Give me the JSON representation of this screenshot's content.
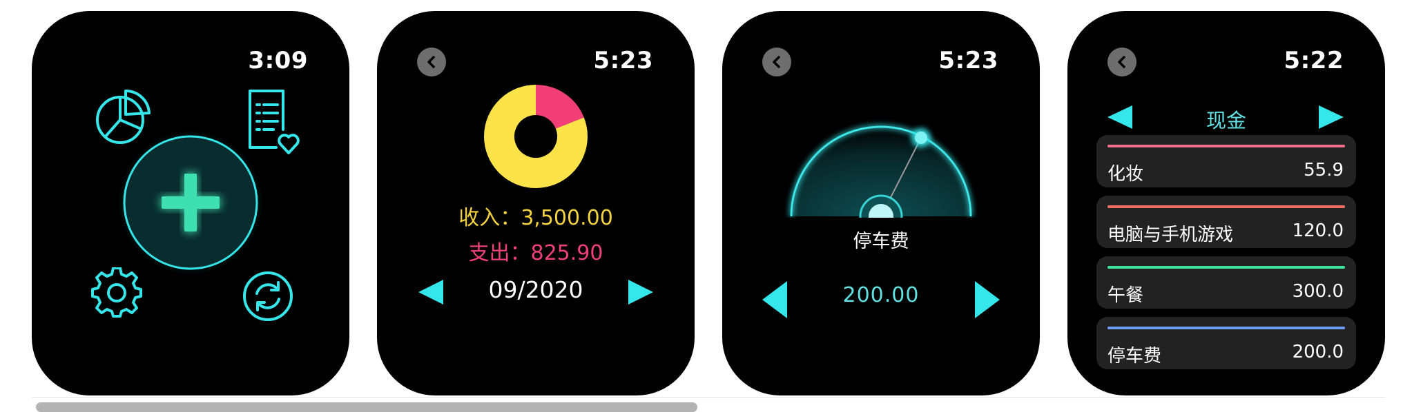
{
  "screens": [
    {
      "time": "3:09"
    },
    {
      "time": "5:23",
      "donut": {
        "income_fraction_pct": 81,
        "expense_fraction_pct": 19,
        "income_color": "#fce34a",
        "expense_color": "#f23f78"
      },
      "income_text": "收入：3,500.00",
      "expense_text": "支出：825.90",
      "month": "09/2020"
    },
    {
      "time": "5:23",
      "category": "停车费",
      "amount": "200.00",
      "gauge_accent": "#3fe4e6"
    },
    {
      "time": "5:22",
      "account": "现金",
      "items": [
        {
          "name": "化妆",
          "value": "55.9",
          "color": "#f2708e"
        },
        {
          "name": "电脑与手机游戏",
          "value": "120.0",
          "color": "#f36e62"
        },
        {
          "name": "午餐",
          "value": "300.0",
          "color": "#3fe59f"
        },
        {
          "name": "停车费",
          "value": "200.0",
          "color": "#6f9bf3"
        }
      ]
    }
  ],
  "icons": {
    "chart": "pie-chart-icon",
    "report": "report-heart-icon",
    "add": "plus-icon",
    "settings": "gear-icon",
    "sync": "sync-icon",
    "back": "back-chevron-icon",
    "prev": "prev-arrow-icon",
    "next": "next-arrow-icon"
  },
  "colors": {
    "accent_cyan": "#35e6ea",
    "plus_green": "#3ee0b0",
    "watch_bg": "#000000",
    "card_bg": "#222222"
  }
}
